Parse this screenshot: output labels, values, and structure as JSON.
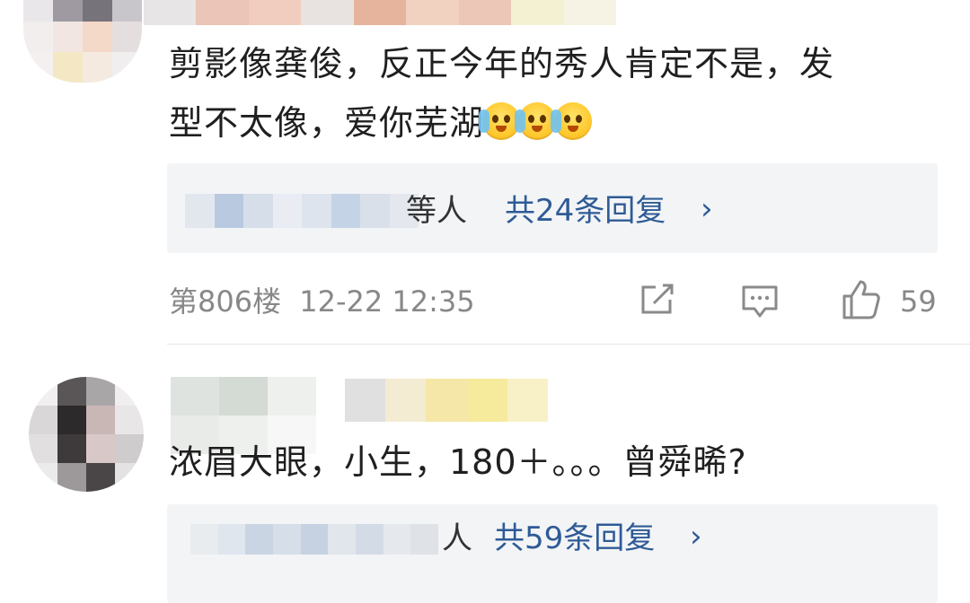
{
  "comments": [
    {
      "text_line1": "剪影像龚俊，反正今年的秀人肯定不是，发",
      "text_line2": "型不太像，爱你芜湖",
      "emoji_count": 3,
      "emoji_icon": "crying-laughing-emoji",
      "replies": {
        "names_suffix": "等人",
        "count_label": "共24条回复",
        "chevron": "›"
      },
      "floor": "第806楼",
      "timestamp": "12-22 12:35",
      "likes": "59"
    },
    {
      "text": "浓眉大眼，小生，180＋。。。曾舜晞?",
      "replies": {
        "names_suffix": "人",
        "count_label": "共59条回复",
        "chevron": "›"
      }
    }
  ],
  "icons": [
    "share-icon",
    "comment-icon",
    "like-icon"
  ],
  "colors": {
    "link": "#2e5b96",
    "meta": "#888888",
    "reply_bg": "#f3f4f6"
  }
}
